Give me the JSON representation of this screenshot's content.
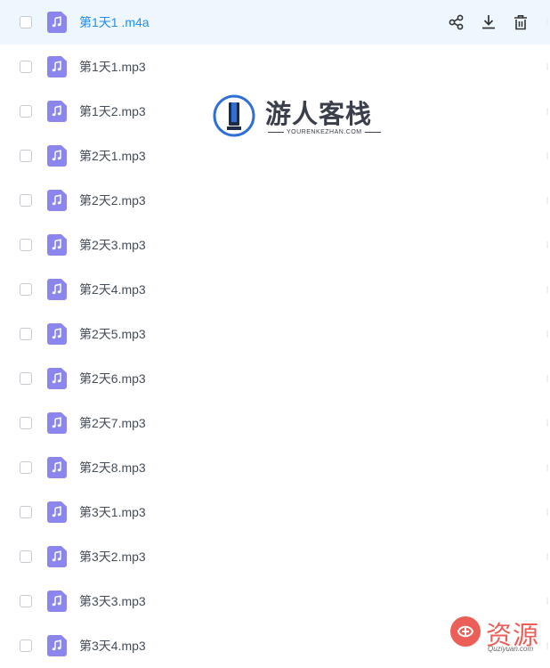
{
  "files": [
    {
      "name": "第1天1 .m4a",
      "selected": true
    },
    {
      "name": "第1天1.mp3"
    },
    {
      "name": "第1天2.mp3"
    },
    {
      "name": "第2天1.mp3"
    },
    {
      "name": "第2天2.mp3"
    },
    {
      "name": "第2天3.mp3"
    },
    {
      "name": "第2天4.mp3"
    },
    {
      "name": "第2天5.mp3"
    },
    {
      "name": "第2天6.mp3"
    },
    {
      "name": "第2天7.mp3"
    },
    {
      "name": "第2天8.mp3"
    },
    {
      "name": "第3天1.mp3"
    },
    {
      "name": "第3天2.mp3"
    },
    {
      "name": "第3天3.mp3"
    },
    {
      "name": "第3天4.mp3"
    }
  ],
  "row_actions": [
    {
      "name": "share-icon"
    },
    {
      "name": "download-icon"
    },
    {
      "name": "delete-icon"
    }
  ],
  "watermark": {
    "title": "游人客栈",
    "subtitle": "YOURENKEZHAN.COM"
  },
  "corner_watermark": {
    "text": "资源",
    "sub": "Quziyuan.com"
  },
  "colors": {
    "selected_row_bg": "#eef6fe",
    "selected_text": "#1e8ff2",
    "file_icon": "#8b85ee",
    "text": "#454d5a",
    "corner_mark": "#e9423c"
  }
}
